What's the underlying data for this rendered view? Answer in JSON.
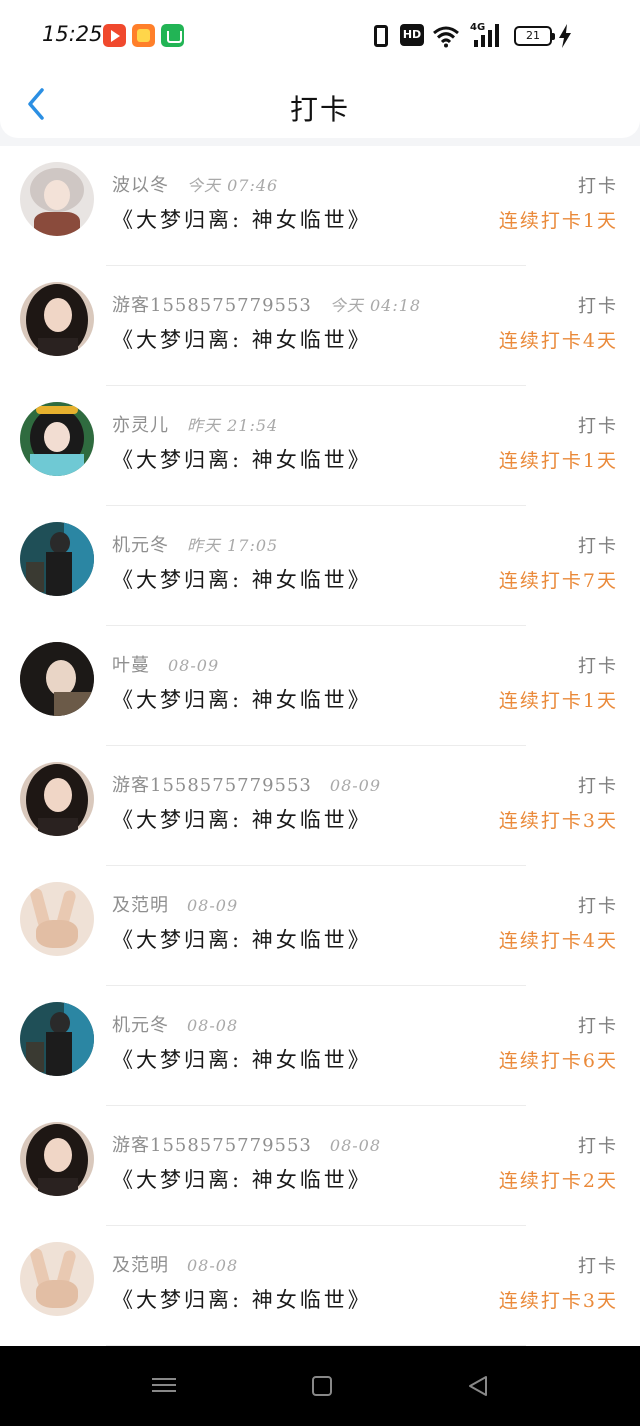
{
  "status_bar": {
    "time": "15:25",
    "icons": [
      "video-app-icon",
      "shop-app-icon",
      "bag-app-icon",
      "vibrate-icon",
      "hd-icon",
      "wifi-icon",
      "signal-icon",
      "battery-icon",
      "charging-icon"
    ],
    "hd_label": "HD",
    "network_label": "4G",
    "battery_level": "21"
  },
  "header": {
    "title": "打卡",
    "back_icon": "chevron-left-icon",
    "accent_color": "#2b8fe3"
  },
  "colors": {
    "streak": "#ea8a3a",
    "name": "#8f8f8f",
    "book": "#1a1a1a"
  },
  "checkins": [
    {
      "name": "波以冬",
      "time": "今天 07:46",
      "book": "《大梦归离: 神女临世》",
      "action": "打卡",
      "streak": "连续打卡1天"
    },
    {
      "name": "游客1558575779553",
      "time": "今天 04:18",
      "book": "《大梦归离: 神女临世》",
      "action": "打卡",
      "streak": "连续打卡4天"
    },
    {
      "name": "亦灵儿",
      "time": "昨天 21:54",
      "book": "《大梦归离: 神女临世》",
      "action": "打卡",
      "streak": "连续打卡1天"
    },
    {
      "name": "机元冬",
      "time": "昨天 17:05",
      "book": "《大梦归离: 神女临世》",
      "action": "打卡",
      "streak": "连续打卡7天"
    },
    {
      "name": "叶蔓",
      "time": "08-09",
      "book": "《大梦归离: 神女临世》",
      "action": "打卡",
      "streak": "连续打卡1天"
    },
    {
      "name": "游客1558575779553",
      "time": "08-09",
      "book": "《大梦归离: 神女临世》",
      "action": "打卡",
      "streak": "连续打卡3天"
    },
    {
      "name": "及范明",
      "time": "08-09",
      "book": "《大梦归离: 神女临世》",
      "action": "打卡",
      "streak": "连续打卡4天"
    },
    {
      "name": "机元冬",
      "time": "08-08",
      "book": "《大梦归离: 神女临世》",
      "action": "打卡",
      "streak": "连续打卡6天"
    },
    {
      "name": "游客1558575779553",
      "time": "08-08",
      "book": "《大梦归离: 神女临世》",
      "action": "打卡",
      "streak": "连续打卡2天"
    },
    {
      "name": "及范明",
      "time": "08-08",
      "book": "《大梦归离: 神女临世》",
      "action": "打卡",
      "streak": "连续打卡3天"
    }
  ],
  "system_nav": {
    "icons": [
      "menu-icon",
      "home-icon",
      "back-triangle-icon"
    ]
  }
}
